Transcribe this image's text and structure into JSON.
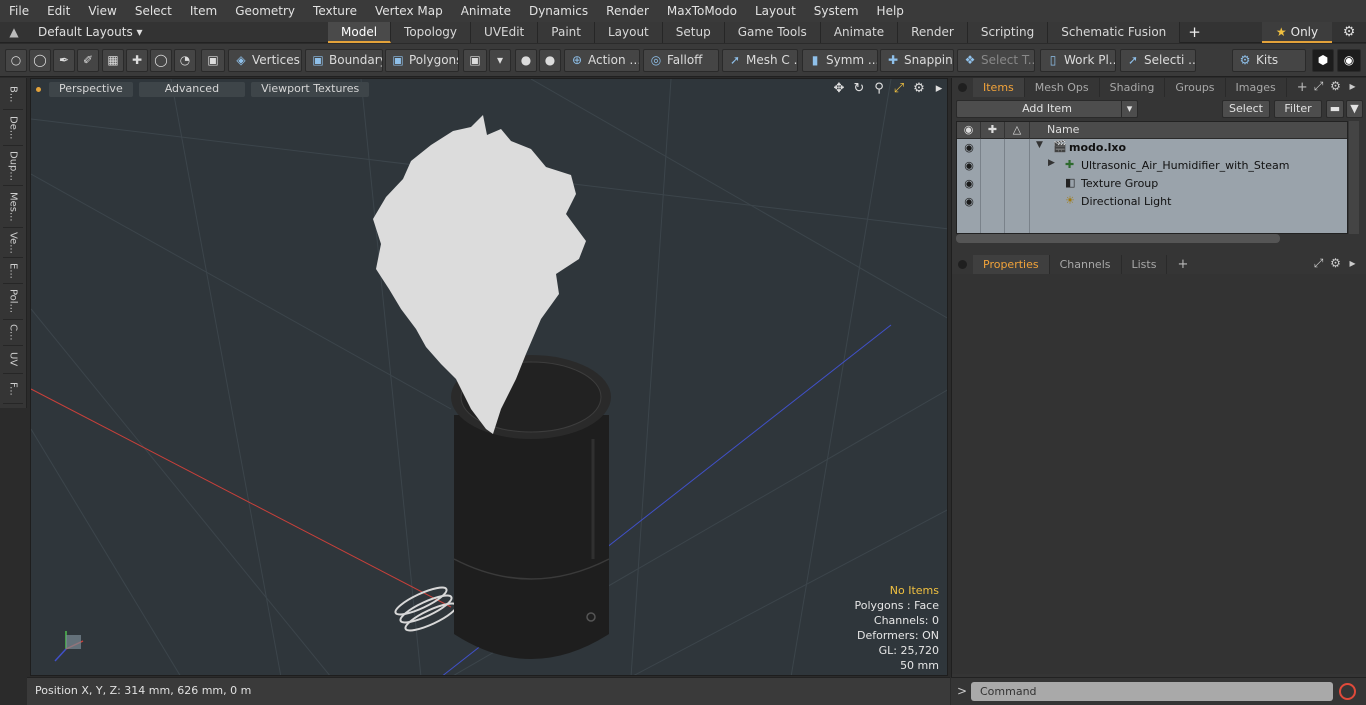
{
  "menu": [
    "File",
    "Edit",
    "View",
    "Select",
    "Item",
    "Geometry",
    "Texture",
    "Vertex Map",
    "Animate",
    "Dynamics",
    "Render",
    "MaxToModo",
    "Layout",
    "System",
    "Help"
  ],
  "layouts_label": "Default Layouts ▾",
  "tabs": [
    "Model",
    "Topology",
    "UVEdit",
    "Paint",
    "Layout",
    "Setup",
    "Game Tools",
    "Animate",
    "Render",
    "Scripting",
    "Schematic Fusion"
  ],
  "tabs_plus": "+",
  "only_label": "Only",
  "toolbar": {
    "vertices": "Vertices",
    "boundary": "Boundary",
    "polygons": "Polygons",
    "action": "Action",
    "falloff": "Falloff",
    "mesh_c": "Mesh C ...",
    "symm": "Symm ...",
    "snapping": "Snapping",
    "select_t": "Select T...",
    "work_pl": "Work Pl...",
    "selecti": "Selecti ...",
    "kits": "Kits"
  },
  "left_tabs": [
    "B...",
    "De...",
    "Dup...",
    "Mes...",
    "Ve...",
    "E...",
    "Pol...",
    "C...",
    "UV",
    "F..."
  ],
  "viewport": {
    "perspective": "Perspective",
    "advanced": "Advanced",
    "viewport_textures": "Viewport Textures",
    "hud": {
      "no_items": "No Items",
      "polygons": "Polygons : Face",
      "channels": "Channels: 0",
      "deformers": "Deformers: ON",
      "gl": "GL: 25,720",
      "scale": "50 mm"
    }
  },
  "status": {
    "position": "Position X, Y, Z:   314 mm, 626 mm, 0 m"
  },
  "items_panel": {
    "tabs": [
      "Items",
      "Mesh Ops",
      "Shading",
      "Groups",
      "Images"
    ],
    "add_item": "Add Item",
    "select": "Select",
    "filter": "Filter",
    "name_header": "Name",
    "rows": [
      {
        "label": "modo.lxo",
        "icon": "scene-icon"
      },
      {
        "label": "Ultrasonic_Air_Humidifier_with_Steam",
        "icon": "mesh-locator-icon"
      },
      {
        "label": "Texture Group",
        "icon": "texture-group-icon"
      },
      {
        "label": "Directional Light",
        "icon": "directional-light-icon"
      }
    ]
  },
  "properties_panel": {
    "tabs": [
      "Properties",
      "Channels",
      "Lists"
    ]
  },
  "command": {
    "prompt": ">",
    "placeholder": "Command"
  },
  "colors": {
    "accent": "#e3a23a",
    "viewport_bg": "#2f363b",
    "x_axis": "#c8403a",
    "z_axis": "#4050c8"
  }
}
